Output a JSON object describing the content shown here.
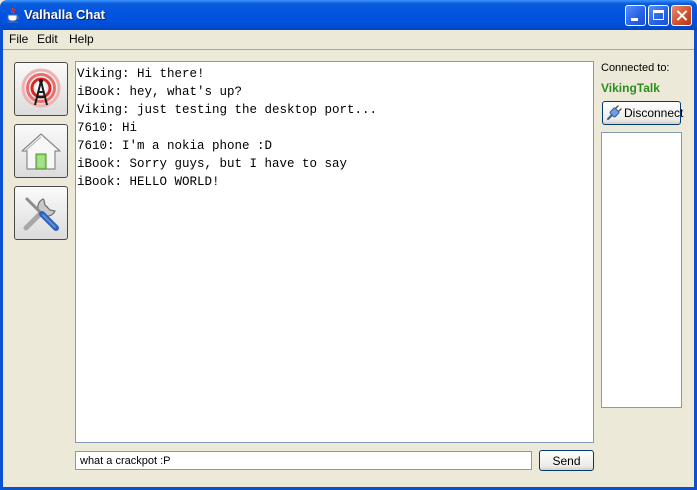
{
  "window": {
    "title": "Valhalla Chat"
  },
  "menu": {
    "file": "File",
    "edit": "Edit",
    "help": "Help"
  },
  "toolbar": {
    "icons": [
      "broadcast-tower-icon",
      "home-icon",
      "tools-icon"
    ]
  },
  "chat": {
    "lines": [
      "Viking: Hi there!",
      "iBook: hey, what's up?",
      "Viking: just testing the desktop port...",
      "7610: Hi",
      "7610: I'm a nokia phone :D",
      "iBook: Sorry guys, but I have to say",
      "iBook: HELLO WORLD!"
    ]
  },
  "input": {
    "value": "what a crackpot :P"
  },
  "send_label": "Send",
  "connection": {
    "label": "Connected to:",
    "server": "VikingTalk",
    "server_color": "#2D8F1E",
    "disconnect_label": "Disconnect"
  },
  "users": []
}
